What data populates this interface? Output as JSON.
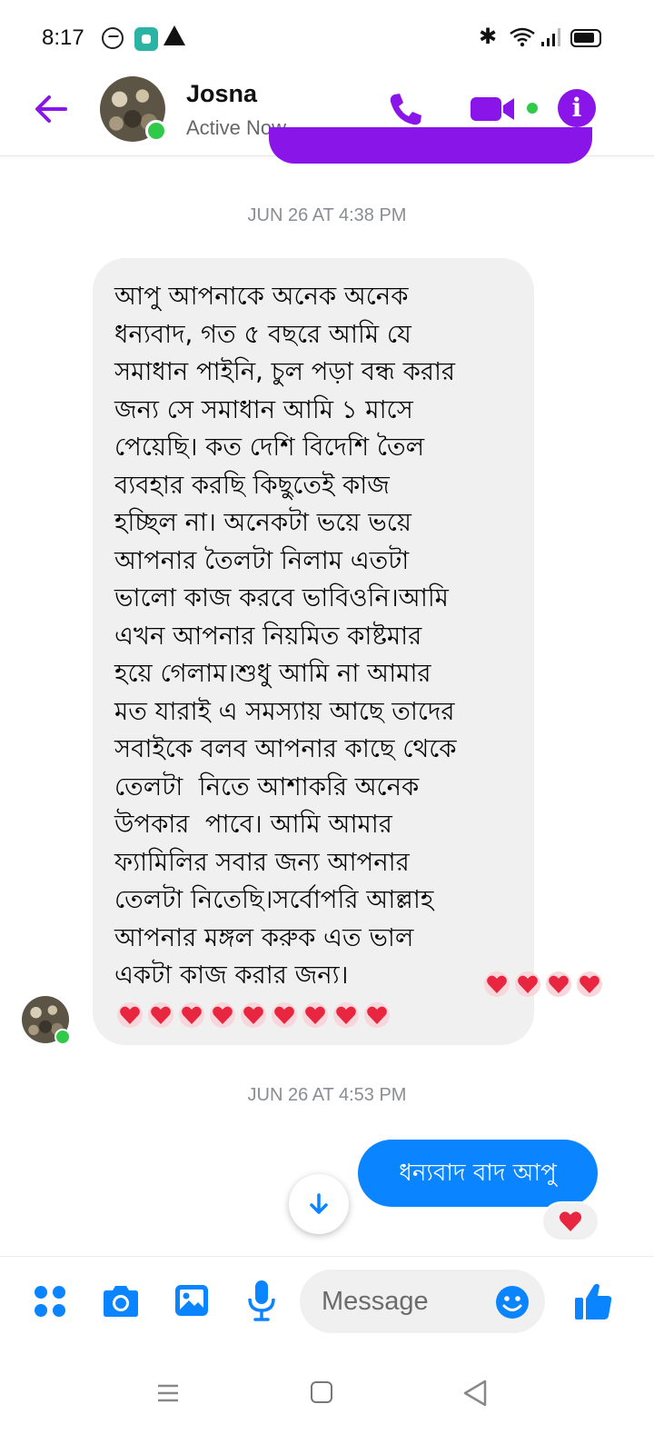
{
  "status_bar": {
    "time": "8:17"
  },
  "header": {
    "contact_name": "Josna",
    "contact_status": "Active Now"
  },
  "messages": [
    {
      "type": "timestamp",
      "text": "JUN 26 AT 4:38 PM"
    },
    {
      "type": "incoming",
      "text": "আপু আপনাকে অনেক অনেক\nধন্যবাদ, গত ৫ বছরে আমি যে\nসমাধান পাইনি, চুল পড়া বন্ধ করার\nজন্য সে সমাধান আমি ১ মাসে\nপেয়েছি। কত দেশি বিদেশি তৈল\nব্যবহার করছি কিছুতেই কাজ\nহচ্ছিল না। অনেকটা ভয়ে ভয়ে\nআপনার তৈলটা নিলাম এতটা\nভালো কাজ করবে ভাবিওনি।আমি\nএখন আপনার নিয়মিত কাষ্টমার\nহয়ে গেলাম।শুধু আমি না আমার\nমত যারাই এ সমস্যায় আছে তাদের\nসবাইকে বলব আপনার কাছে থেকে\nতেলটা  নিতে আশাকরি অনেক\nউপকার  পাবে। আমি আমার\nফ্যামিলির সবার জন্য আপনার\nতেলটা নিতেছি।সর্বোপরি আল্লাহ\nআপনার মঙ্গল করুক এত ভাল\nএকটা কাজ করার জন্য।",
      "heart_count": 13
    },
    {
      "type": "timestamp",
      "text": "JUN 26 AT 4:53 PM"
    },
    {
      "type": "outgoing",
      "text": "ধন্যবাদ  বাদ আপু",
      "reaction": "heart"
    }
  ],
  "composer": {
    "placeholder": "Message"
  },
  "colors": {
    "accent": "#8a15e8",
    "outgoing_bubble": "#0b84ff",
    "incoming_bubble": "#f0f0f0",
    "presence": "#31c94a",
    "timestamp": "#8a8d91",
    "heart": "#e8263f"
  },
  "icons": [
    "messenger-icon",
    "app-icon",
    "warning-icon",
    "bluetooth-icon",
    "wifi-icon",
    "signal-icon",
    "battery-icon",
    "back-arrow-icon",
    "phone-icon",
    "video-camera-icon",
    "info-icon",
    "chevron-down-icon",
    "apps-icon",
    "camera-icon",
    "gallery-icon",
    "microphone-icon",
    "emoji-icon",
    "thumbs-up-icon",
    "heart-icon"
  ]
}
